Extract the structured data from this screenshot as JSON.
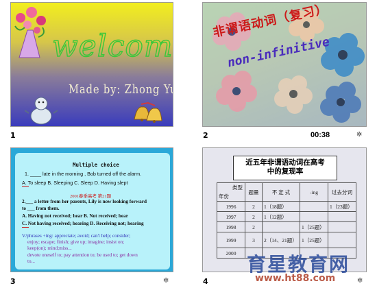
{
  "slides": [
    {
      "number": "1",
      "welcome": "welcome",
      "made_by": "Made by: Zhong Yuping"
    },
    {
      "number": "2",
      "title_cn": "非谓语动词（复习）",
      "title_en": "non-infinitive",
      "time": "00:38"
    },
    {
      "number": "3",
      "heading": "Multiple choice",
      "q1": "1. ____ late in the morning , Bob turned off the alarm.",
      "q1_options": "A. To sleep   B. Sleeping   C. Sleep   D. Having slept",
      "note": "2001春季高考 第21题",
      "q2": "2.___ a letter from her parents, Lily is now looking forward",
      "q2b": "to ___ from them.",
      "q2_opt1": "A.  Having not received; hear    B. Not received; hear",
      "q2_opt2": "C.  Not having received; hearing   D. Receiving not; hearing",
      "phr1": "V/phrases +ing:  appreciate; avoid; can't help; consider;",
      "phr2": "enjoy; escape; finish; give up; imagine; insist on;",
      "phr3": "keep(on); mind;miss...",
      "phr4": "devote oneself to; pay attention to; be used to; get down",
      "phr5": "to..."
    },
    {
      "number": "4",
      "title_line1": "近五年非谓语动词在高考",
      "title_line2": "中的复现率",
      "table": {
        "header_type": "类型",
        "header_year": "年份",
        "columns": [
          "题量",
          "不 定 式",
          "-ing",
          "过去分词"
        ],
        "rows": [
          [
            "1996",
            "2",
            "1（18题）",
            "",
            "1（23题）"
          ],
          [
            "1997",
            "2",
            "1（12题）",
            "",
            ""
          ],
          [
            "1998",
            "2",
            "",
            "1（25题）",
            ""
          ],
          [
            "1999",
            "3",
            "2（14、21题）",
            "1（25题）",
            ""
          ],
          [
            "2000",
            "",
            "",
            "",
            ""
          ]
        ]
      }
    }
  ],
  "watermark": {
    "cn": "育星教育网",
    "url": "www.ht88.com"
  },
  "icons": [
    "star-icon",
    "star-icon",
    "star-icon"
  ]
}
